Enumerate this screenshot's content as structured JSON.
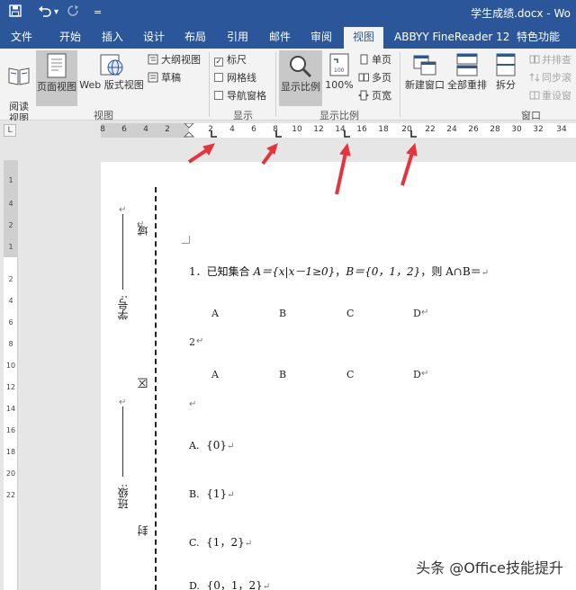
{
  "titlebar": {
    "doc_title": "学生成绩.docx - Wo",
    "qa_dropdown_glyph": "▾",
    "qa_more_glyph": "=",
    "qa_save_icon": "save-icon",
    "qa_undo_icon": "undo-icon",
    "qa_redo_icon": "redo-icon"
  },
  "tabs": [
    {
      "label": "文件"
    },
    {
      "label": "开始"
    },
    {
      "label": "插入"
    },
    {
      "label": "设计"
    },
    {
      "label": "布局"
    },
    {
      "label": "引用"
    },
    {
      "label": "邮件"
    },
    {
      "label": "审阅"
    },
    {
      "label": "视图",
      "active": true
    },
    {
      "label": "ABBYY FineReader 12"
    },
    {
      "label": "特色功能"
    }
  ],
  "ribbon": {
    "views": {
      "read_mode": "阅读\n视图",
      "print_layout": "页面视图",
      "web_layout": "Web 版式视图",
      "outline": "大纲视图",
      "draft": "草稿",
      "group_label": "视图"
    },
    "show": {
      "ruler": "标尺",
      "ruler_checked": "✓",
      "gridlines": "网格线",
      "nav_pane": "导航窗格",
      "group_label": "显示"
    },
    "zoom": {
      "zoom": "显示比例",
      "percent": "100%",
      "one_page": "单页",
      "multi_page": "多页",
      "page_width": "页宽",
      "group_label": "显示比例"
    },
    "window": {
      "new_window": "新建窗口",
      "arrange_all": "全部重排",
      "split": "拆分",
      "side_by_side": "并排查",
      "sync_scroll": "同步滚",
      "reset_pos": "重设窗",
      "group_label": "窗口"
    }
  },
  "ruler": {
    "corner_glyph": "L",
    "labels": [
      "8",
      "6",
      "4",
      "2",
      "2",
      "4",
      "6",
      "8",
      "10",
      "12",
      "14",
      "16",
      "18",
      "20",
      "22",
      "24",
      "26",
      "28",
      "30",
      "32",
      "34"
    ],
    "vlabels": [
      "1",
      "4",
      "2",
      "1",
      "2",
      "4",
      "6",
      "8",
      "10",
      "12",
      "14",
      "16",
      "18",
      "20",
      "22"
    ]
  },
  "page": {
    "binding": {
      "seal1": "域",
      "student_no": "学号:",
      "seal2": "区",
      "class_label": "班级:",
      "seal3": "封",
      "mark": "↵"
    },
    "q1": {
      "prefix": "1．已知集合 ",
      "math_a": "A＝{x|x－1≥0}",
      "sep": "，",
      "math_b": "B＝{0，1，2}",
      "suffix": "，则 A∩B＝",
      "mark": "↵"
    },
    "opt_row1": [
      "A",
      "B",
      "C",
      "D"
    ],
    "d_mark": "↵",
    "line2": "2",
    "line2_mark": "↵",
    "opt_row2": [
      "A",
      "B",
      "C",
      "D"
    ],
    "empty_mark": "↵",
    "answers": [
      {
        "label": "A.",
        "value": "{0}",
        "mark": "↵"
      },
      {
        "label": "B.",
        "value": "{1}",
        "mark": "↵"
      },
      {
        "label": "C.",
        "value": "{1，2}",
        "mark": "↵"
      },
      {
        "label": "D.",
        "value": "{0，1，2}",
        "mark": "↵"
      }
    ]
  },
  "watermark": "头条 @Office技能提升",
  "colors": {
    "accent": "#2b579a",
    "arrow": "#e8323c"
  }
}
